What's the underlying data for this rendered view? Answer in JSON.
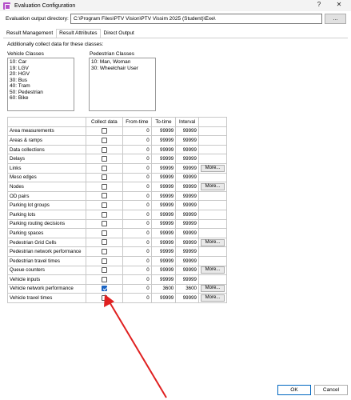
{
  "window": {
    "title": "Evaluation Configuration",
    "help_glyph": "?",
    "close_glyph": "✕",
    "icon": "app-icon"
  },
  "output_dir": {
    "label": "Evaluation output directory:",
    "value": "C:\\Program Files\\PTV Vision\\PTV Vissim 2025 (Student)\\Exe\\",
    "browse_label": "..."
  },
  "tabs": [
    {
      "label": "Result Management",
      "active": false
    },
    {
      "label": "Result Attributes",
      "active": true
    },
    {
      "label": "Direct Output",
      "active": false
    }
  ],
  "classes": {
    "heading": "Additionally collect data for these classes:",
    "vehicle_label": "Vehicle Classes",
    "vehicle": [
      "10: Car",
      "19: LGV",
      "20: HGV",
      "30: Bus",
      "40: Tram",
      "50: Pedestrian",
      "60: Bike"
    ],
    "pedestrian_label": "Pedestrian Classes",
    "pedestrian": [
      "10: Man, Woman",
      "30: Wheelchair User"
    ]
  },
  "grid": {
    "headers": {
      "name": "",
      "collect": "Collect data",
      "from": "From-time",
      "to": "To-time",
      "interval": "Interval",
      "more": ""
    },
    "rows": [
      {
        "name": "Area measurements",
        "collect": false,
        "from": "0",
        "to": "99999",
        "interval": "99999",
        "more": ""
      },
      {
        "name": "Areas & ramps",
        "collect": false,
        "from": "0",
        "to": "99999",
        "interval": "99999",
        "more": ""
      },
      {
        "name": "Data collections",
        "collect": false,
        "from": "0",
        "to": "99999",
        "interval": "99999",
        "more": ""
      },
      {
        "name": "Delays",
        "collect": false,
        "from": "0",
        "to": "99999",
        "interval": "99999",
        "more": ""
      },
      {
        "name": "Links",
        "collect": false,
        "from": "0",
        "to": "99999",
        "interval": "99999",
        "more": "More..."
      },
      {
        "name": "Meso edges",
        "collect": false,
        "from": "0",
        "to": "99999",
        "interval": "99999",
        "more": ""
      },
      {
        "name": "Nodes",
        "collect": false,
        "from": "0",
        "to": "99999",
        "interval": "99999",
        "more": "More..."
      },
      {
        "name": "OD pairs",
        "collect": false,
        "from": "0",
        "to": "99999",
        "interval": "99999",
        "more": ""
      },
      {
        "name": "Parking lot groups",
        "collect": false,
        "from": "0",
        "to": "99999",
        "interval": "99999",
        "more": ""
      },
      {
        "name": "Parking lots",
        "collect": false,
        "from": "0",
        "to": "99999",
        "interval": "99999",
        "more": ""
      },
      {
        "name": "Parking routing decisions",
        "collect": false,
        "from": "0",
        "to": "99999",
        "interval": "99999",
        "more": ""
      },
      {
        "name": "Parking spaces",
        "collect": false,
        "from": "0",
        "to": "99999",
        "interval": "99999",
        "more": ""
      },
      {
        "name": "Pedestrian Grid Cells",
        "collect": false,
        "from": "0",
        "to": "99999",
        "interval": "99999",
        "more": "More..."
      },
      {
        "name": "Pedestrian network performance",
        "collect": false,
        "from": "0",
        "to": "99999",
        "interval": "99999",
        "more": ""
      },
      {
        "name": "Pedestrian travel times",
        "collect": false,
        "from": "0",
        "to": "99999",
        "interval": "99999",
        "more": ""
      },
      {
        "name": "Queue counters",
        "collect": false,
        "from": "0",
        "to": "99999",
        "interval": "99999",
        "more": "More..."
      },
      {
        "name": "Vehicle inputs",
        "collect": false,
        "from": "0",
        "to": "99999",
        "interval": "99999",
        "more": ""
      },
      {
        "name": "Vehicle network performance",
        "collect": true,
        "from": "0",
        "to": "3600",
        "interval": "3600",
        "more": "More..."
      },
      {
        "name": "Vehicle travel times",
        "collect": false,
        "from": "0",
        "to": "99999",
        "interval": "99999",
        "more": "More..."
      }
    ]
  },
  "buttons": {
    "ok": "OK",
    "cancel": "Cancel"
  },
  "colors": {
    "accent": "#1a63c2",
    "arrow": "#e02020"
  }
}
